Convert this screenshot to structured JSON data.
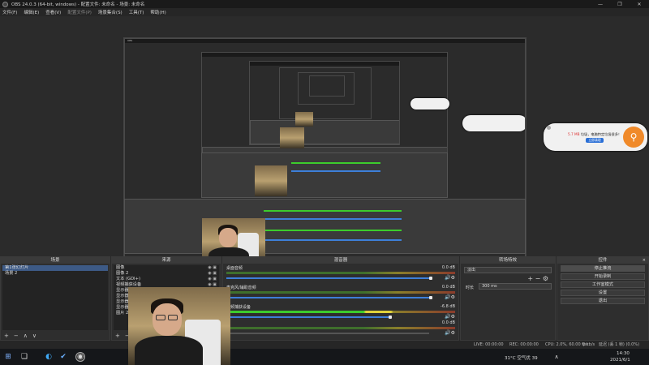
{
  "window": {
    "title": "OBS 24.0.3 (64-bit, windows) - 配置文件: 未命名 - 场景: 未命名"
  },
  "menu": [
    "文件(F)",
    "编辑(E)",
    "查看(V)",
    "配置文件(P)",
    "场景集合(S)",
    "工具(T)",
    "帮助(H)"
  ],
  "window_buttons": [
    "—",
    "❐",
    "✕"
  ],
  "notification": {
    "count_text": "5.7 MB",
    "message": "垃圾，电脑特定垃圾很多！",
    "button": "立即清理"
  },
  "docks": {
    "scenes": {
      "title": "场景",
      "items": [
        "第1张幻灯片",
        "场景 2"
      ],
      "footer": [
        "+",
        "−",
        "∧",
        "∨"
      ]
    },
    "sources": {
      "title": "来源",
      "items": [
        "图像",
        "图像 2",
        "文本 (GDI+)",
        "视频捕获设备",
        "显示器捕获",
        "显示器捕获 2",
        "显示器捕获 3",
        "显示器捕获 4",
        "图片 2"
      ],
      "footer": [
        "+",
        "−",
        "⚙"
      ]
    },
    "mixer": {
      "title": "混音器",
      "tracks": [
        {
          "name": "桌面音频",
          "db": "0.0 dB",
          "level": 0.0
        },
        {
          "name": "麦克风/辅助音频",
          "db": "0.0 dB",
          "level": 0.0
        },
        {
          "name": "视频捕获设备",
          "db": "-6.8 dB",
          "level": 0.52
        },
        {
          "name": "",
          "db": "0.0 dB",
          "level": 0.0
        }
      ]
    },
    "transitions": {
      "title": "转场特效",
      "selected": "淡出",
      "duration_label": "时长",
      "duration_value": "300 ms"
    },
    "controls": {
      "title": "控件",
      "buttons": [
        "停止推流",
        "开始录制",
        "工作室模式",
        "设置",
        "退出"
      ]
    }
  },
  "status": {
    "live": "LIVE: 00:00:00",
    "rec": "REC: 00:00:00",
    "cpu": "CPU: 2.0%, 60.00 fps",
    "kbps": "0 kb/s",
    "dropped": "延迟 (丢 1 帧) (0.0%)"
  },
  "taskbar": {
    "weather": "31°C 空气优 39",
    "time": "14:30",
    "date": "2021/6/1"
  },
  "colors": {
    "accent_blue": "#3d7fd9",
    "meter_green": "#3ccc2c",
    "notif_orange": "#f08a2a"
  }
}
